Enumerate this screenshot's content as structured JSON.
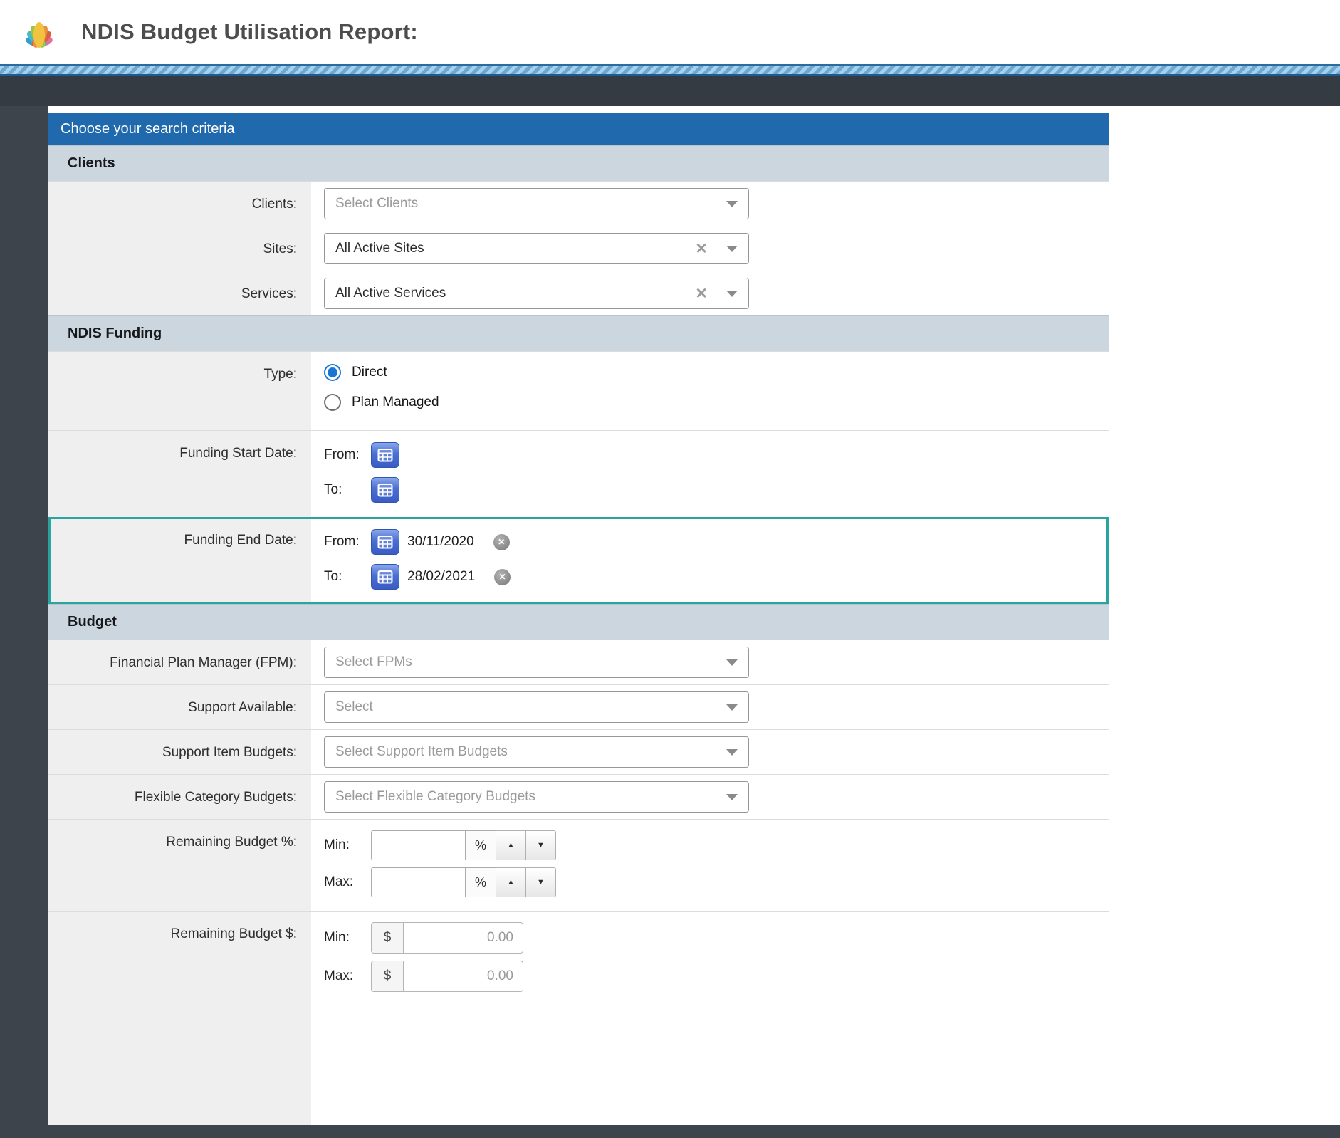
{
  "app": {
    "title": "NDIS Budget Utilisation Report:"
  },
  "panel": {
    "title": "Choose your search criteria"
  },
  "sections": {
    "clients": {
      "title": "Clients",
      "clients_label": "Clients:",
      "clients_placeholder": "Select Clients",
      "sites_label": "Sites:",
      "sites_value": "All Active Sites",
      "services_label": "Services:",
      "services_value": "All Active Services"
    },
    "funding": {
      "title": "NDIS Funding",
      "type_label": "Type:",
      "direct_label": "Direct",
      "direct_selected": true,
      "plan_managed_label": "Plan Managed",
      "plan_managed_selected": false,
      "start_label": "Funding Start Date:",
      "end_label": "Funding End Date:",
      "from_label": "From:",
      "to_label": "To:",
      "start_from_value": "",
      "start_to_value": "",
      "end_from_value": "30/11/2020",
      "end_to_value": "28/02/2021"
    },
    "budget": {
      "title": "Budget",
      "fpm_label": "Financial Plan Manager (FPM):",
      "fpm_placeholder": "Select FPMs",
      "support_available_label": "Support Available:",
      "support_available_placeholder": "Select",
      "support_item_label": "Support Item Budgets:",
      "support_item_placeholder": "Select Support Item Budgets",
      "flexible_label": "Flexible Category Budgets:",
      "flexible_placeholder": "Select Flexible Category Budgets",
      "pct_label": "Remaining Budget %:",
      "dollar_label": "Remaining Budget $:",
      "min_label": "Min:",
      "max_label": "Max:",
      "percent_unit": "%",
      "dollar_unit": "$",
      "pct_min_value": "",
      "pct_max_value": "",
      "amount_placeholder": "0.00"
    }
  },
  "icons": {
    "clear": "✕",
    "spinner_up": "▲",
    "spinner_down": "▼"
  },
  "colors": {
    "panel_header_bg": "#2069ac",
    "section_header_bg": "#ccd6df",
    "highlight_border": "#2aa49f",
    "radio_selected": "#1b76d2",
    "calendar_button": "#4a6ed2",
    "dark_chrome": "#3d444c",
    "stripe_light": "#a6d2ec",
    "stripe_dark": "#6ea7d0"
  }
}
